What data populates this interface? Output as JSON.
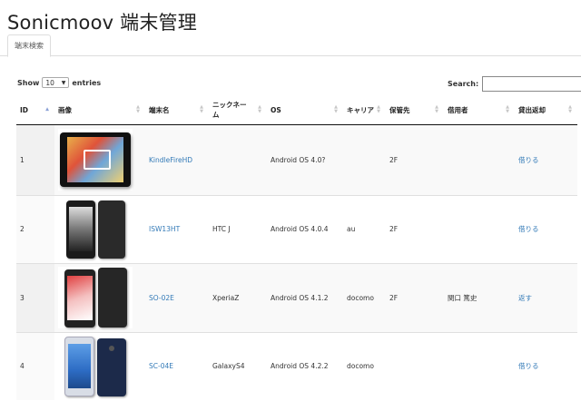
{
  "page": {
    "title": "Sonicmoov 端末管理"
  },
  "tabs": [
    {
      "label": "端末検索",
      "active": true
    }
  ],
  "controls": {
    "show_label": "Show",
    "page_length": "10",
    "entries_label": "entries",
    "search_label": "Search:",
    "search_value": ""
  },
  "table": {
    "columns": [
      {
        "label": "ID",
        "sort": "asc"
      },
      {
        "label": "画像",
        "sort": "both"
      },
      {
        "label": "端末名",
        "sort": "both"
      },
      {
        "label": "ニックネーム",
        "sort": "both"
      },
      {
        "label": "OS",
        "sort": "both"
      },
      {
        "label": "キャリア",
        "sort": "both"
      },
      {
        "label": "保管先",
        "sort": "both"
      },
      {
        "label": "借用者",
        "sort": "both"
      },
      {
        "label": "貸出返却",
        "sort": "both"
      }
    ],
    "rows": [
      {
        "id": "1",
        "image": "tablet-image",
        "device": "KindleFireHD",
        "nickname": "",
        "os": "Android OS 4.0?",
        "carrier": "",
        "storage": "2F",
        "borrower": "",
        "action": "借りる"
      },
      {
        "id": "2",
        "image": "phone-image",
        "device": "ISW13HT",
        "nickname": "HTC J",
        "os": "Android OS 4.0.4",
        "carrier": "au",
        "storage": "2F",
        "borrower": "",
        "action": "借りる"
      },
      {
        "id": "3",
        "image": "phone-image",
        "device": "SO-02E",
        "nickname": "XperiaZ",
        "os": "Android OS 4.1.2",
        "carrier": "docomo",
        "storage": "2F",
        "borrower": "関口 篤史",
        "action": "返す"
      },
      {
        "id": "4",
        "image": "phone-image",
        "device": "SC-04E",
        "nickname": "GalaxyS4",
        "os": "Android OS 4.2.2",
        "carrier": "docomo",
        "storage": "",
        "borrower": "",
        "action": "借りる"
      }
    ]
  },
  "colors": {
    "link": "#337ab7",
    "row_stripe": "#f9f9f9",
    "header_border": "#111111"
  }
}
